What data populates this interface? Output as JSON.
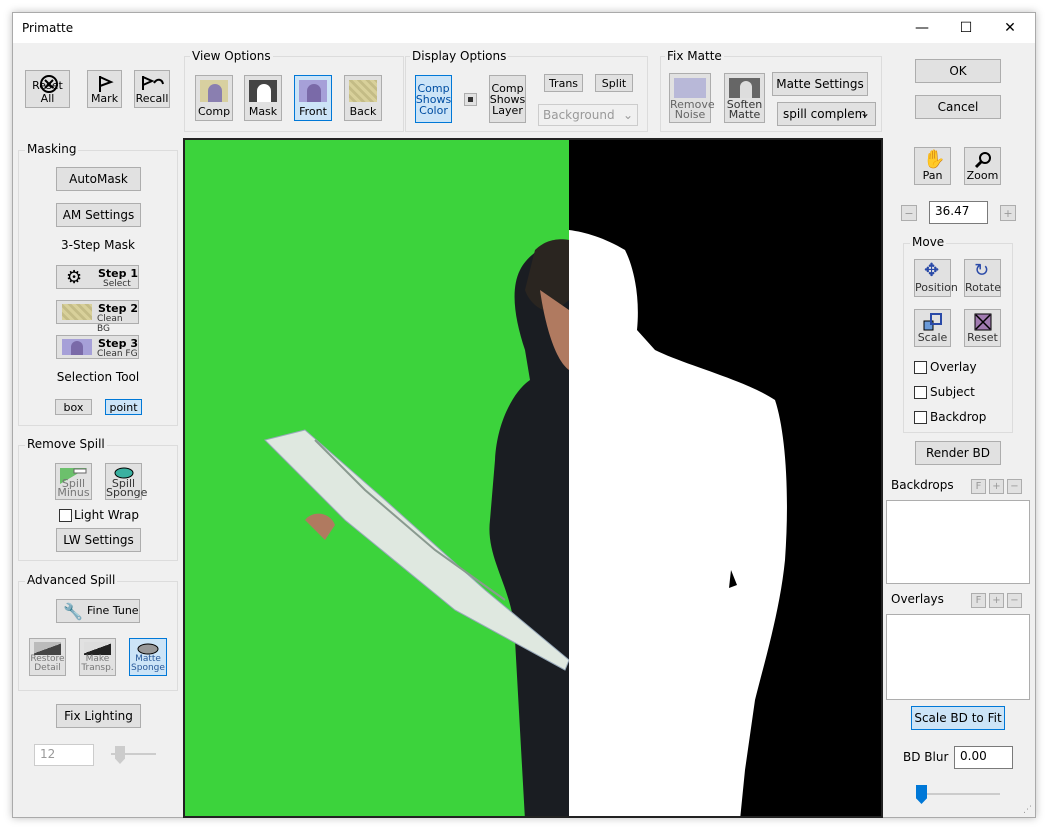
{
  "window": {
    "title": "Primatte",
    "minimize": "—",
    "maximize": "☐",
    "close": "✕"
  },
  "toolbar": {
    "reset_all": "Reset All",
    "mark": "Mark",
    "recall": "Recall"
  },
  "view_options": {
    "title": "View Options",
    "comp": "Comp",
    "mask": "Mask",
    "front": "Front",
    "back": "Back",
    "selected": "Front"
  },
  "display_options": {
    "title": "Display Options",
    "comp_shows_color": "Comp Shows Color",
    "comp_shows_layer": "Comp Shows Layer",
    "trans": "Trans",
    "split": "Split",
    "background": "Background"
  },
  "fix_matte": {
    "title": "Fix Matte",
    "remove_noise": "Remove Noise",
    "soften_matte": "Soften Matte",
    "matte_settings": "Matte Settings",
    "spill_select": "spill complem"
  },
  "dialog": {
    "ok": "OK",
    "cancel": "Cancel"
  },
  "masking": {
    "title": "Masking",
    "automask": "AutoMask",
    "am_settings": "AM Settings",
    "three_step": "3-Step Mask",
    "step1": "Step 1",
    "step1_sub": "Select",
    "step2": "Step 2",
    "step2_sub": "Clean BG",
    "step3": "Step 3",
    "step3_sub": "Clean FG",
    "selection_tool": "Selection Tool",
    "box": "box",
    "point": "point",
    "selected_tool": "point"
  },
  "remove_spill": {
    "title": "Remove Spill",
    "spill_minus": "Spill Minus",
    "spill_sponge": "Spill Sponge",
    "light_wrap": "Light Wrap",
    "lw_settings": "LW Settings",
    "light_wrap_checked": false
  },
  "advanced_spill": {
    "title": "Advanced Spill",
    "fine_tune": "Fine Tune",
    "restore_detail": "Restore Detail",
    "make_transp": "Make Transp.",
    "matte_sponge": "Matte Sponge"
  },
  "fix_lighting": {
    "label": "Fix Lighting",
    "value": "12"
  },
  "nav": {
    "pan": "Pan",
    "zoom": "Zoom",
    "zoom_value": "36.47",
    "minus": "−",
    "plus": "+"
  },
  "move": {
    "title": "Move",
    "position": "Position",
    "rotate": "Rotate",
    "scale": "Scale",
    "reset": "Reset",
    "overlay": "Overlay",
    "subject": "Subject",
    "backdrop": "Backdrop"
  },
  "render_bd": "Render BD",
  "backdrops": {
    "title": "Backdrops",
    "f": "F",
    "plus": "+",
    "minus": "−"
  },
  "overlays": {
    "title": "Overlays",
    "f": "F",
    "plus": "+",
    "minus": "−"
  },
  "scale_bd_fit": "Scale BD to Fit",
  "bd_blur": {
    "label": "BD Blur",
    "value": "0.00"
  },
  "colors": {
    "green_screen": "#3cd33c",
    "matte_bg": "#000000",
    "selected": "#cce4f7",
    "accent": "#0078d7"
  }
}
